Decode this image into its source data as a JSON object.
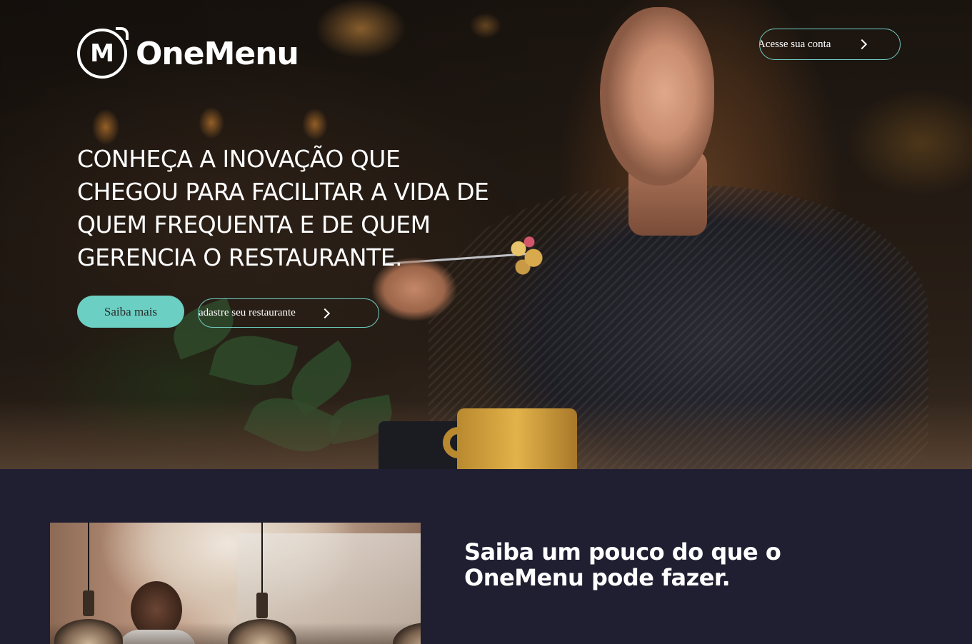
{
  "header": {
    "logo_letter": "M",
    "logo_text": "OneMenu",
    "account_button": "Acesse sua conta"
  },
  "hero": {
    "headline": "CONHEÇA A INOVAÇÃO QUE CHEGOU PARA FACILITAR A VIDA DE QUEM FREQUENTA E DE QUEM GERENCIA O RESTAURANTE.",
    "primary_button": "Saiba mais",
    "secondary_button": "Cadastre seu restaurante"
  },
  "about": {
    "title": "Saiba um pouco do que o OneMenu pode fazer."
  },
  "colors": {
    "accent": "#6ccfc3",
    "section_background": "#201e31"
  },
  "icons": {
    "account_button": "chevron-right-icon",
    "secondary_button": "chevron-right-icon"
  }
}
